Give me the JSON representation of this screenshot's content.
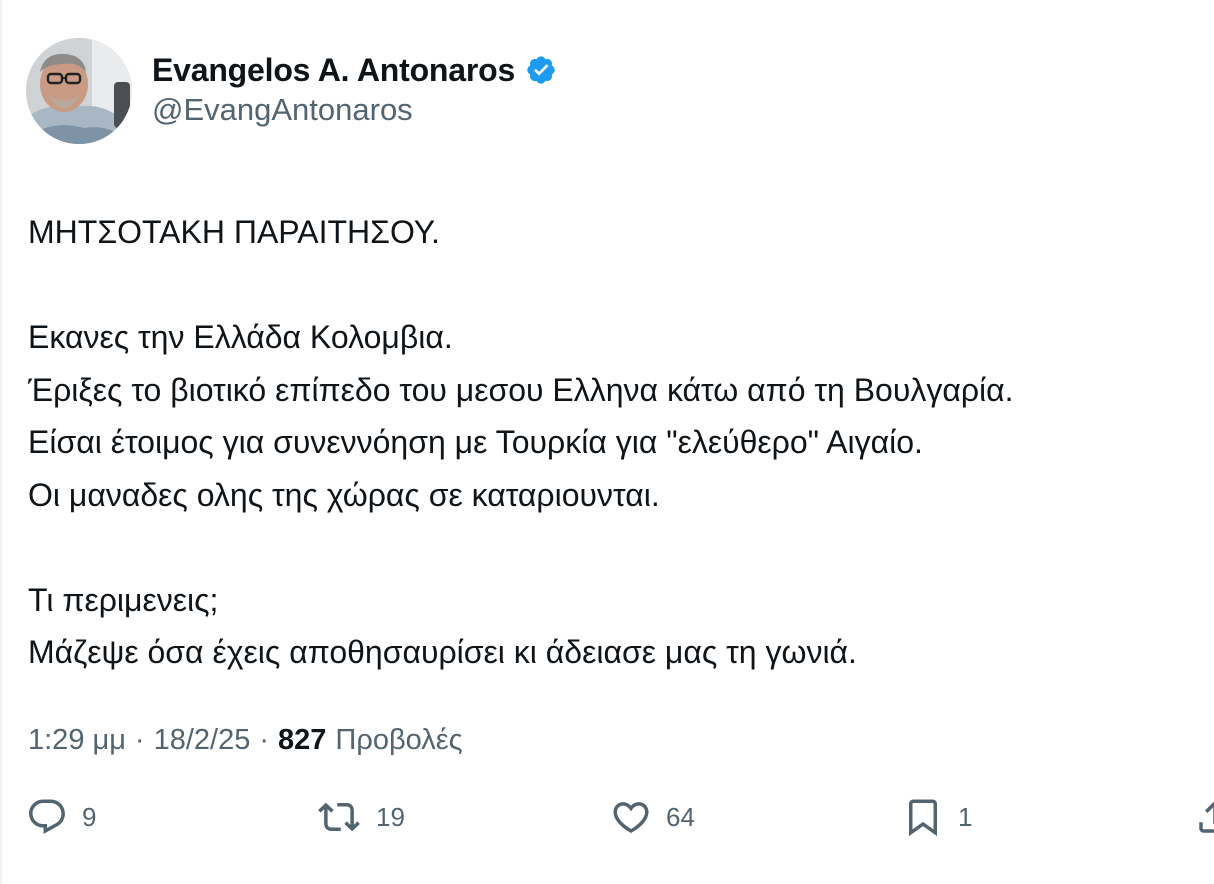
{
  "author": {
    "display_name": "Evangelos A. Antonaros",
    "handle": "@EvangAntonaros",
    "verified_color": "#1d9bf0"
  },
  "tweet": {
    "lines": [
      "ΜΗΤΣΟΤΑΚΗ ΠΑΡΑΙΤΗΣΟΥ.",
      "",
      "Εκανες την Ελλάδα Κολομβια.",
      "Έριξες το βιοτικό επίπεδο του μεσου Ελληνα κάτω από τη Βουλγαρία.",
      "Είσαι έτοιμος για συνεννόηση με Τουρκία για \"ελεύθερο\" Αιγαίο.",
      "Οι μαναδες ολης της χώρας σε καταριουνται.",
      "",
      "Τι περιμενεις;",
      "Μάζεψε όσα έχεις αποθησαυρίσει κι άδειασε μας τη γωνιά."
    ]
  },
  "meta": {
    "time": "1:29 μμ",
    "separator": "·",
    "date": "18/2/25",
    "views_count": "827",
    "views_label": "Προβολές"
  },
  "actions": {
    "replies": "9",
    "reposts": "19",
    "likes": "64",
    "bookmarks": "1"
  },
  "icons": {
    "reply": "reply-icon",
    "repost": "repost-icon",
    "like": "heart-icon",
    "bookmark": "bookmark-icon",
    "share": "share-icon",
    "verified": "verified-badge-icon"
  },
  "colors": {
    "text_primary": "#0f1419",
    "text_secondary": "#536471",
    "accent": "#1d9bf0"
  }
}
